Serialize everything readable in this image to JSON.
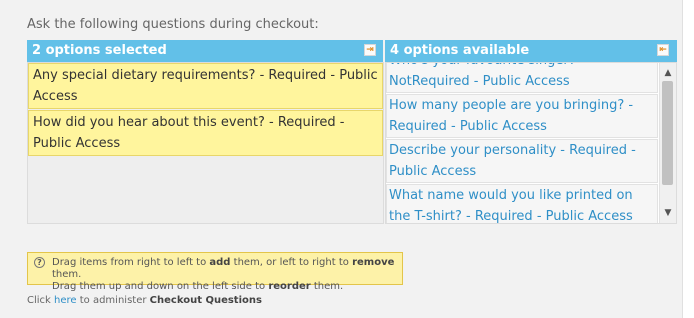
{
  "heading": "Ask the following questions during checkout:",
  "selected": {
    "header": "2 options selected",
    "button_icon": "move-all-right-icon",
    "items": [
      "Any special dietary requirements? - Required - Public Access",
      "How did you hear about this event? - Required - Public Access"
    ]
  },
  "available": {
    "header": "4 options available",
    "button_icon": "move-all-left-icon",
    "items": [
      "Who's your favourite singer? - NotRequired - Public Access",
      "How many people are you bringing? - Required - Public Access",
      "Describe your personality - Required - Public Access",
      "What name would you like printed on the T-shirt? - Required - Public Access"
    ]
  },
  "help": {
    "icon": "question-icon",
    "line1_pre": "Drag items from right to left to ",
    "line1_add": "add",
    "line1_mid": " them, or left to right to ",
    "line1_remove": "remove",
    "line1_post": " them.",
    "line2_pre": "Drag them up and down on the left side to ",
    "line2_reorder": "reorder",
    "line2_post": " them."
  },
  "footer": {
    "pre": "Click ",
    "link": "here",
    "mid": " to administer ",
    "bold": "Checkout Questions"
  }
}
